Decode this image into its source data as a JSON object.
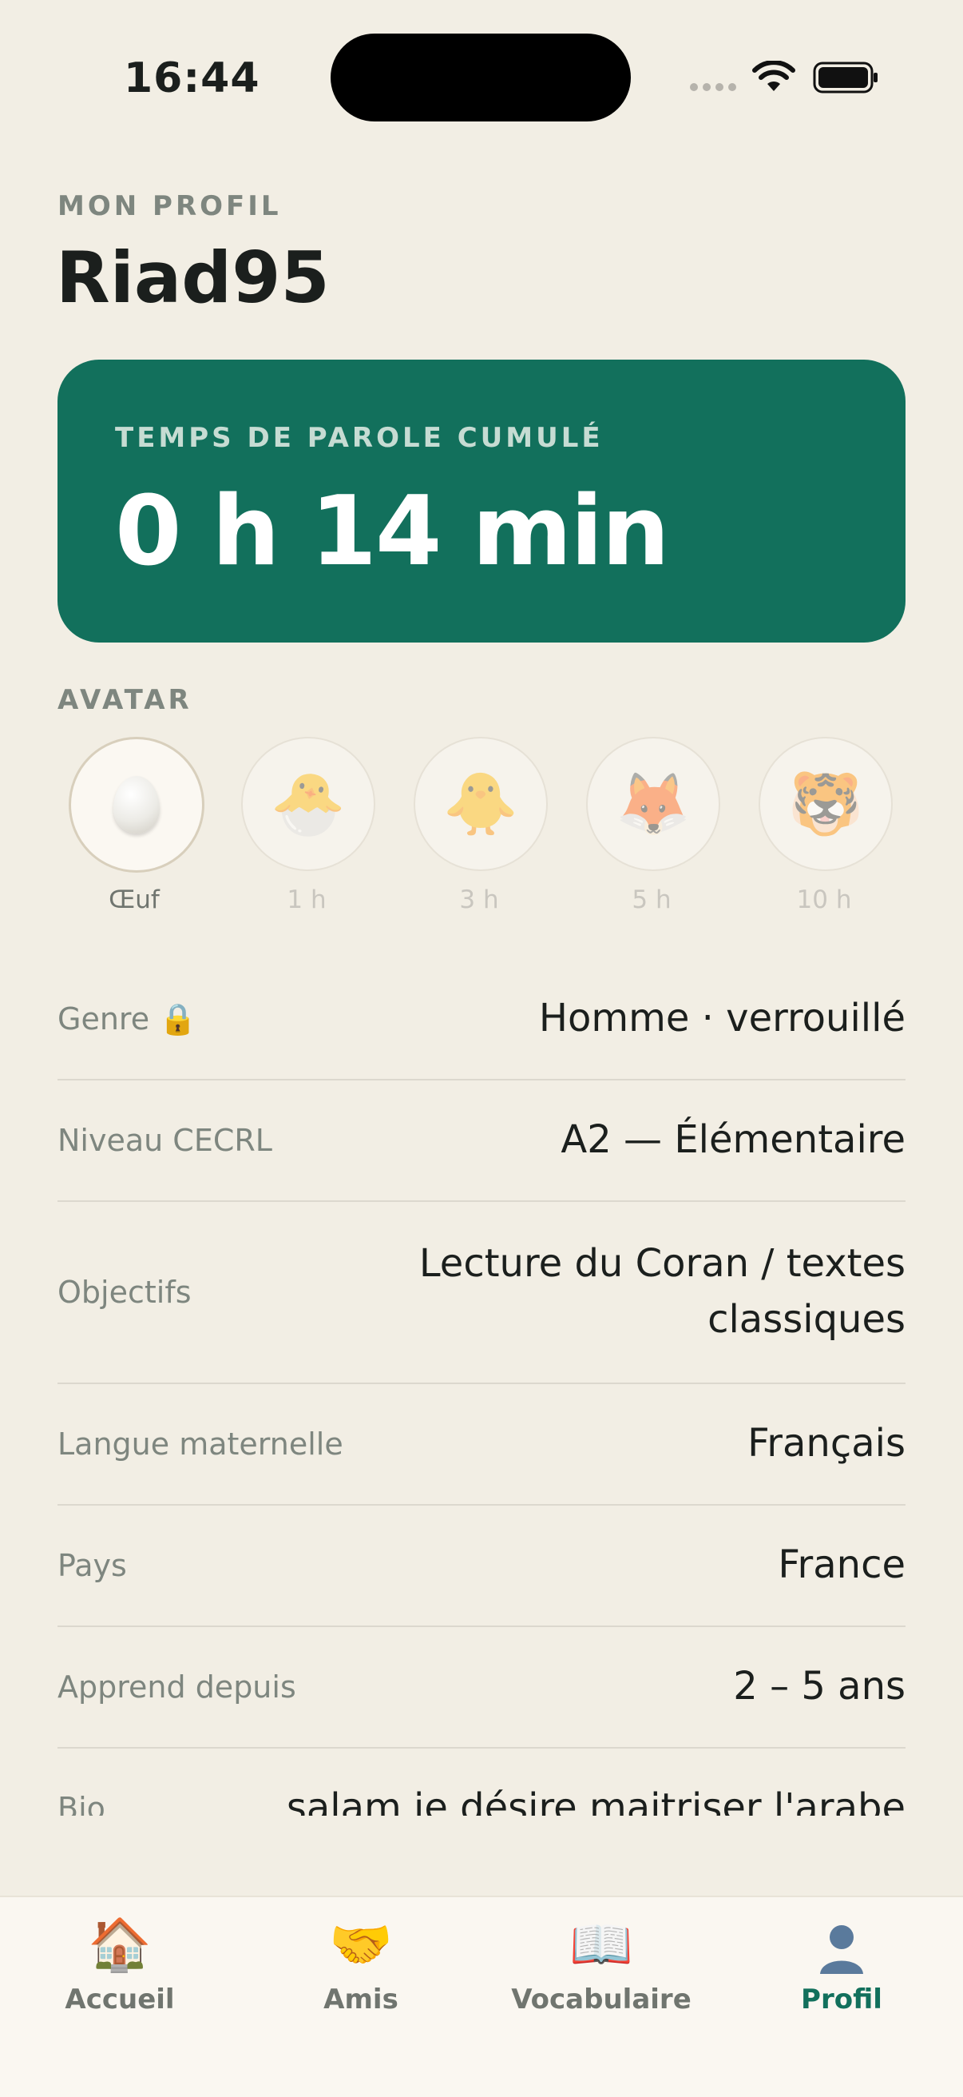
{
  "status_bar": {
    "time": "16:44"
  },
  "header": {
    "section_label": "MON PROFIL",
    "username": "Riad95"
  },
  "speaking_card": {
    "label": "TEMPS DE PAROLE CUMULÉ",
    "value": "0 h 14 min",
    "color": "#12705c"
  },
  "avatar_section": {
    "label": "AVATAR",
    "items": [
      {
        "label": "Œuf",
        "icon": "egg-icon",
        "selected": true
      },
      {
        "label": "1 h",
        "icon": "hatching-chick-icon",
        "glyph": "🐣",
        "selected": false
      },
      {
        "label": "3 h",
        "icon": "chick-icon",
        "glyph": "🐥",
        "selected": false
      },
      {
        "label": "5 h",
        "icon": "fox-icon",
        "glyph": "🦊",
        "selected": false
      },
      {
        "label": "10 h",
        "icon": "tiger-icon",
        "glyph": "🐯",
        "selected": false
      }
    ]
  },
  "profile_rows": [
    {
      "label": "Genre 🔒",
      "value": "Homme · verrouillé"
    },
    {
      "label": "Niveau CECRL",
      "value": "A2 — Élémentaire"
    },
    {
      "label": "Objectifs",
      "value_line1": "Lecture du Coran / textes",
      "value_line2": "classiques"
    },
    {
      "label": "Langue maternelle",
      "value": "Français"
    },
    {
      "label": "Pays",
      "value": "France"
    },
    {
      "label": "Apprend depuis",
      "value": "2 – 5 ans"
    },
    {
      "label": "Bio",
      "value": "salam je désire maitriser l'arabe"
    }
  ],
  "tabbar": {
    "tabs": [
      {
        "label": "Accueil",
        "icon": "house-icon",
        "glyph": "🏠"
      },
      {
        "label": "Amis",
        "icon": "handshake-icon",
        "glyph": "🤝"
      },
      {
        "label": "Vocabulaire",
        "icon": "open-book-icon",
        "glyph": "📖"
      },
      {
        "label": "Profil",
        "icon": "person-silhouette-icon",
        "glyph": "👤",
        "active": true
      }
    ],
    "accent_color": "#12705c"
  }
}
